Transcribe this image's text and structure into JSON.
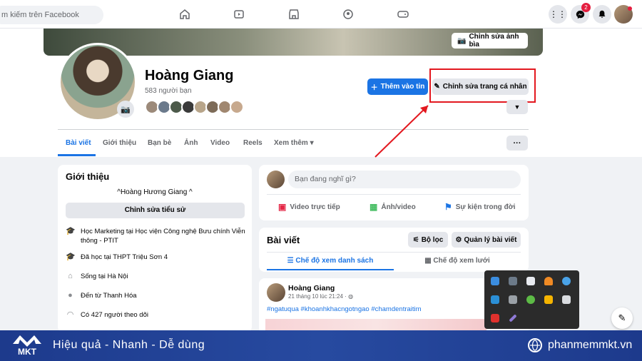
{
  "topnav": {
    "search_placeholder": "m kiếm trên Facebook",
    "messenger_badge": "2"
  },
  "cover": {
    "edit_button": "Chỉnh sửa ảnh bìa"
  },
  "profile": {
    "name": "Hoàng Giang",
    "friends": "583 người bạn",
    "add_story": "Thêm vào tin",
    "edit_profile": "Chỉnh sửa trang cá nhân"
  },
  "tabs": [
    "Bài viết",
    "Giới thiệu",
    "Bạn bè",
    "Ảnh",
    "Video",
    "Reels",
    "Xem thêm"
  ],
  "intro": {
    "title": "Giới thiệu",
    "bio": "^Hoàng Hương Giang ^",
    "edit_bio": "Chỉnh sửa tiểu sử",
    "rows": [
      {
        "icon": "graduation-cap-icon",
        "text": "Học Marketing tại Học viện Công nghệ Bưu chính Viễn thông - PTIT"
      },
      {
        "icon": "graduation-cap-icon",
        "text": "Đã học tại THPT Triệu Sơn 4"
      },
      {
        "icon": "home-icon",
        "text": "Sống tại Hà Nội"
      },
      {
        "icon": "location-pin-icon",
        "text": "Đến từ Thanh Hóa"
      },
      {
        "icon": "rss-icon",
        "text": "Có 427 người theo dõi"
      }
    ]
  },
  "composer": {
    "placeholder": "Bạn đang nghĩ gì?",
    "live": "Video trực tiếp",
    "photo": "Ảnh/video",
    "event": "Sự kiện trong đời"
  },
  "posts": {
    "title": "Bài viết",
    "filter": "Bộ lọc",
    "manage": "Quản lý bài viết",
    "list_view": "Chế độ xem danh sách",
    "grid_view": "Chế độ xem lưới"
  },
  "post": {
    "author": "Hoàng Giang",
    "time": "21 tháng 10 lúc 21:24 ·",
    "tags": "#ngatuqua #khoanhkhacngotngao #chamdentraitim"
  },
  "banner": {
    "logo_text": "MKT",
    "slogan": "Hiệu quả - Nhanh - Dễ dùng",
    "website": "phanmemmkt.vn"
  },
  "colors": {
    "accent": "#1b74e4",
    "highlight": "#e3181f",
    "banner": "#1d3a8c"
  }
}
